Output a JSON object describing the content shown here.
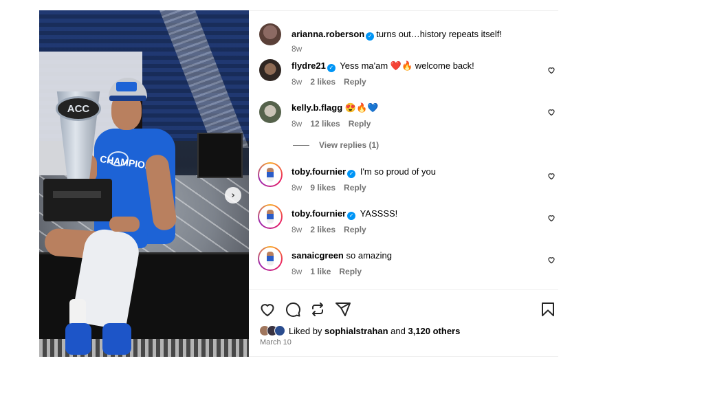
{
  "post": {
    "caption": {
      "username": "arianna.roberson",
      "verified": true,
      "text": "turns out…history repeats itself!",
      "time": "8w"
    },
    "photo": {
      "trophy_text": "ACC",
      "shirt_text": "CHAMPIONS",
      "next_icon": "chevron-right-icon"
    },
    "comments": [
      {
        "username": "flydre21",
        "verified": true,
        "text": "Yess ma'am ❤️🔥 welcome back!",
        "time": "8w",
        "likes": "2 likes",
        "reply": "Reply"
      },
      {
        "username": "kelly.b.flagg",
        "verified": false,
        "text": "😍🔥💙",
        "time": "8w",
        "likes": "12 likes",
        "reply": "Reply",
        "view_replies": "View replies (1)"
      },
      {
        "username": "toby.fournier",
        "verified": true,
        "text": "I'm so proud of you",
        "time": "8w",
        "likes": "9 likes",
        "reply": "Reply"
      },
      {
        "username": "toby.fournier",
        "verified": true,
        "text": "YASSSS!",
        "time": "8w",
        "likes": "2 likes",
        "reply": "Reply"
      },
      {
        "username": "sanaicgreen",
        "verified": false,
        "text": "so amazing",
        "time": "8w",
        "likes": "1 like",
        "reply": "Reply"
      }
    ],
    "actions": {
      "icons": [
        "heart-icon",
        "comment-icon",
        "repost-icon",
        "share-icon",
        "bookmark-icon"
      ]
    },
    "likes": {
      "prefix": "Liked by",
      "user": "sophialstrahan",
      "conj": "and",
      "others": "3,120 others"
    },
    "date": "March 10"
  },
  "colors": {
    "verified": "#0095f6",
    "meta": "#737373",
    "shirt": "#1d63d6"
  }
}
